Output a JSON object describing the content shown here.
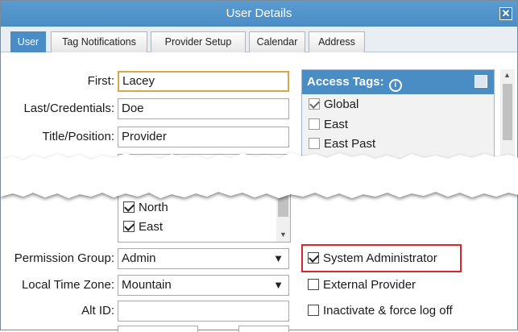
{
  "window": {
    "title": "User Details",
    "close_icon": "close-icon"
  },
  "tabs": [
    {
      "label": "User",
      "active": true
    },
    {
      "label": "Tag Notifications",
      "active": false
    },
    {
      "label": "Provider Setup",
      "active": false
    },
    {
      "label": "Calendar",
      "active": false
    },
    {
      "label": "Address",
      "active": false
    }
  ],
  "form": {
    "first_label": "First:",
    "first_value": "Lacey",
    "last_label": "Last/Credentials:",
    "last_value": "Doe",
    "title_label": "Title/Position:",
    "title_value": "Provider",
    "permission_label": "Permission Group:",
    "permission_value": "Admin",
    "timezone_label": "Local Time Zone:",
    "timezone_value": "Mountain",
    "altid_label": "Alt ID:",
    "altid_value": ""
  },
  "locations": [
    {
      "label": "North",
      "checked": true
    },
    {
      "label": "East",
      "checked": true
    }
  ],
  "access_tags": {
    "header": "Access Tags:",
    "info_icon": "info-icon",
    "items": [
      {
        "label": "Global",
        "checked": true
      },
      {
        "label": "East",
        "checked": false
      },
      {
        "label": "East Past",
        "checked": false
      }
    ]
  },
  "options": [
    {
      "label": "System Administrator",
      "checked": true,
      "highlighted": true
    },
    {
      "label": "External Provider",
      "checked": false
    },
    {
      "label": "Inactivate & force log off",
      "checked": false
    }
  ],
  "colors": {
    "accent": "#4a8cc4",
    "highlight_border": "#d9262c",
    "focus_border": "#d7a64a"
  }
}
